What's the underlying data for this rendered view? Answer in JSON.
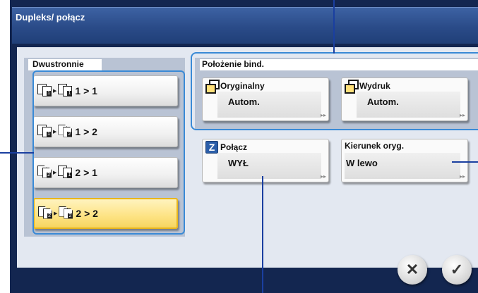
{
  "header": {
    "title": "Dupleks/ połącz"
  },
  "duplex": {
    "label": "Dwustronnie",
    "options": [
      {
        "label": "1 > 1",
        "selected": false,
        "icon": "one-sided-to-one-sided-icon"
      },
      {
        "label": "1 > 2",
        "selected": false,
        "icon": "one-sided-to-two-sided-icon"
      },
      {
        "label": "2 > 1",
        "selected": false,
        "icon": "two-sided-to-one-sided-icon"
      },
      {
        "label": "2 > 2",
        "selected": true,
        "icon": "two-sided-to-two-sided-icon"
      }
    ]
  },
  "binding": {
    "label": "Położenie bind.",
    "original": {
      "label": "Oryginalny",
      "value": "Autom.",
      "icon": "copy-icon"
    },
    "output": {
      "label": "Wydruk",
      "value": "Autom.",
      "icon": "copy-icon"
    }
  },
  "combine": {
    "label": "Połącz",
    "value": "WYŁ",
    "icon": "combine-icon"
  },
  "orientation": {
    "label": "Kierunek oryg.",
    "value": "W lewo"
  },
  "footer": {
    "cancel": "✕",
    "ok": "✓"
  },
  "colors": {
    "accent": "#3a8ad6",
    "selected": "#fde383",
    "panel": "#132650",
    "callout": "#1a3fa0"
  }
}
